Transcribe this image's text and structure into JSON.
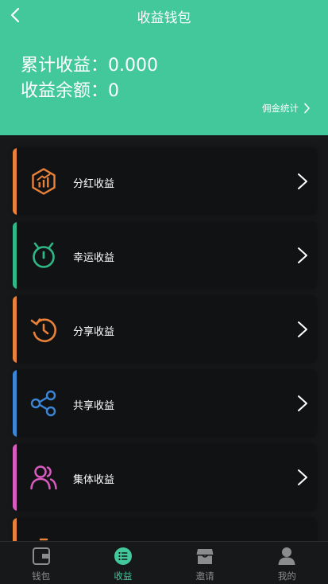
{
  "header": {
    "title": "收益钱包",
    "total_earnings": "累计收益：0.000",
    "earnings_balance": "收益余额：0",
    "commission_stats": "佣金统计"
  },
  "menu": [
    {
      "label": "分红收益",
      "color": "#e8823a",
      "icon": "hexagon-chart-icon"
    },
    {
      "label": "幸运收益",
      "color": "#2fb785",
      "icon": "alarm-clock-icon"
    },
    {
      "label": "分享收益",
      "color": "#e8823a",
      "icon": "timer-refresh-icon"
    },
    {
      "label": "共享收益",
      "color": "#3b86d6",
      "icon": "share-nodes-icon"
    },
    {
      "label": "集体收益",
      "color": "#d95bc0",
      "icon": "users-icon"
    },
    {
      "label": "",
      "color": "#e8823a",
      "icon": "partial-icon"
    }
  ],
  "tabs": [
    {
      "label": "钱包",
      "icon": "wallet-icon",
      "active": false
    },
    {
      "label": "收益",
      "icon": "list-icon",
      "active": true
    },
    {
      "label": "邀请",
      "icon": "store-icon",
      "active": false
    },
    {
      "label": "我的",
      "icon": "user-icon",
      "active": false
    }
  ],
  "colors": {
    "header_bg": "#42c89b",
    "page_bg": "#161819",
    "card_bg": "#111213",
    "active_tab": "#42c89b",
    "inactive_tab": "#8a8c8e"
  }
}
